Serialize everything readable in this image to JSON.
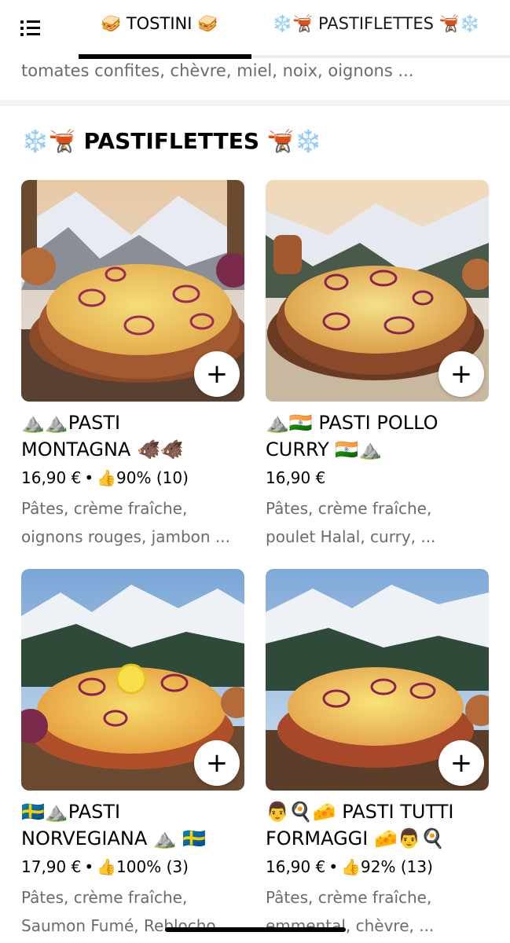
{
  "tabs": [
    {
      "label": "🥪 TOSTINI 🥪"
    },
    {
      "label": "❄️🫕 PASTIFLETTES 🫕❄️"
    }
  ],
  "previous_item_description": "tomates confites, chèvre, miel, noix, oignons ...",
  "section": {
    "title": "❄️🫕 PASTIFLETTES 🫕❄️"
  },
  "items": [
    {
      "name_line1": "⛰️⛰️PASTI",
      "name_line2": "MONTAGNA 🐗🐗",
      "price": "16,90 €",
      "rating": "👍90% (10)",
      "desc_line1": "Pâtes, crème fraîche,",
      "desc_line2": "oignons rouges, jambon ...",
      "add_label": "+"
    },
    {
      "name_line1": "⛰️🇮🇳 PASTI POLLO",
      "name_line2": "CURRY 🇮🇳⛰️",
      "price": "16,90 €",
      "rating": "",
      "desc_line1": "Pâtes,  crème fraîche,",
      "desc_line2": "poulet Halal, curry, ...",
      "add_label": "+"
    },
    {
      "name_line1": "🇸🇪⛰️PASTI",
      "name_line2": "NORVEGIANA ⛰️ 🇸🇪",
      "price": "17,90 €",
      "rating": "👍100% (3)",
      "desc_line1": "Pâtes, crème fraîche,",
      "desc_line2": "Saumon Fumé, Reblocho...",
      "add_label": "+"
    },
    {
      "name_line1": "👨🍳🧀 PASTI TUTTI",
      "name_line2": "FORMAGGI 🧀👨🍳",
      "price": "16,90 €",
      "rating": "👍92% (13)",
      "desc_line1": "Pâtes, crème fraîche,",
      "desc_line2": "emmental, chèvre, ...",
      "add_label": "+"
    }
  ],
  "colors": {
    "text": "#000000",
    "muted": "#6b6b6b",
    "divider": "#f3f3f3"
  }
}
